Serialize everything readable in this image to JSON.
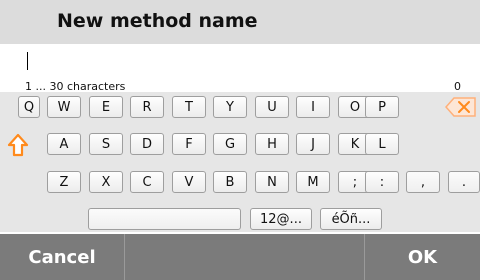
{
  "dialog": {
    "title": "New method name"
  },
  "input": {
    "value": "",
    "hint": "1 ... 30 characters",
    "count": "0"
  },
  "keyboard": {
    "row1": [
      "Q",
      "W",
      "E",
      "R",
      "T",
      "Y",
      "U",
      "I",
      "O",
      "P"
    ],
    "row2": [
      "A",
      "S",
      "D",
      "F",
      "G",
      "H",
      "J",
      "K",
      "L"
    ],
    "row3": [
      "Z",
      "X",
      "C",
      "V",
      "B",
      "N",
      "M",
      ";",
      ":",
      ",",
      "."
    ],
    "numbers_label": "12@...",
    "accents_label": "éÕñ...",
    "shift_icon": "shift-arrow-icon",
    "backspace_icon": "backspace-icon",
    "accent_color": "#ff8a1c"
  },
  "footer": {
    "cancel_label": "Cancel",
    "ok_label": "OK"
  }
}
